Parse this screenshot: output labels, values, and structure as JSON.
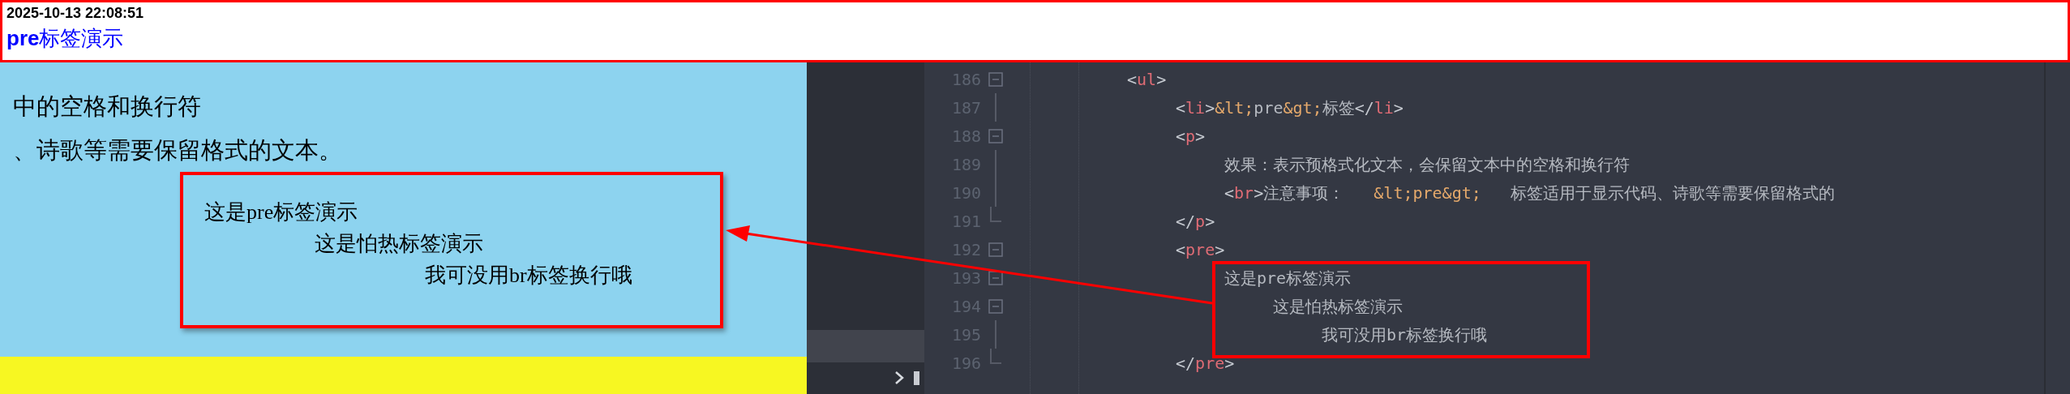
{
  "header": {
    "timestamp": "2025-10-13 22:08:51",
    "title": "**pre**标签演示"
  },
  "preview": {
    "lines": [
      "中的空格和换行符",
      "、诗歌等需要保留格式的文本。"
    ],
    "pre_lines": [
      "这是pre标签演示",
      "这是怕热标签演示",
      "我可没用br标签换行哦"
    ]
  },
  "editor": {
    "lines": [
      {
        "number": "186",
        "kind": "box",
        "tokens": [
          {
            "kind": "punct",
            "text": "<"
          },
          {
            "kind": "tag",
            "text": "ul"
          },
          {
            "kind": "punct",
            "text": ">"
          }
        ],
        "children": [
          {
            "number": "187",
            "kind": "line",
            "tokens": [
              {
                "kind": "punct",
                "text": "<"
              },
              {
                "kind": "tag",
                "text": "li"
              },
              {
                "kind": "punct",
                "text": ">"
              },
              {
                "kind": "entity",
                "text": "&lt;"
              },
              {
                "kind": "text",
                "text": "pre"
              },
              {
                "kind": "entity",
                "text": "&gt;"
              },
              {
                "kind": "text",
                "text": "标签"
              },
              {
                "kind": "punct",
                "text": "</"
              },
              {
                "kind": "tag",
                "text": "li"
              },
              {
                "kind": "punct",
                "text": ">"
              }
            ]
          },
          {
            "number": "188",
            "kind": "box",
            "tokens": [
              {
                "kind": "punct",
                "text": "<"
              },
              {
                "kind": "tag",
                "text": "p"
              },
              {
                "kind": "punct",
                "text": ">"
              }
            ],
            "children": [
              {
                "number": "189",
                "kind": "line",
                "tokens": [
                  {
                    "kind": "text",
                    "text": "效果：表示预格式化文本，会保留文本中的空格和换行符"
                  }
                ]
              },
              {
                "number": "190",
                "kind": "line",
                "tokens": [
                  {
                    "kind": "punct",
                    "text": "<"
                  },
                  {
                    "kind": "tag",
                    "text": "br"
                  },
                  {
                    "kind": "punct",
                    "text": ">"
                  },
                  {
                    "kind": "text",
                    "text": "注意事项：   "
                  },
                  {
                    "kind": "entity",
                    "text": "&lt;pre&gt;"
                  },
                  {
                    "kind": "text",
                    "text": "   标签适用于显示代码、诗歌等需要保留格式的"
                  }
                ]
              }
            ]
          },
          {
            "number": "191",
            "kind": "end",
            "tokens": [
              {
                "kind": "punct",
                "text": "</"
              },
              {
                "kind": "tag",
                "text": "p"
              },
              {
                "kind": "punct",
                "text": ">"
              }
            ]
          },
          {
            "number": "192",
            "kind": "box",
            "tokens": [
              {
                "kind": "punct",
                "text": "<"
              },
              {
                "kind": "tag",
                "text": "pre"
              },
              {
                "kind": "punct",
                "text": ">"
              }
            ],
            "children": [
              {
                "number": "193",
                "kind": "box",
                "tokens": [
                  {
                    "kind": "text",
                    "text": "这是pre标签演示"
                  }
                ],
                "children": [
                  {
                    "number": "194",
                    "kind": "box",
                    "tokens": [
                      {
                        "kind": "text",
                        "text": "这是怕热标签演示"
                      }
                    ],
                    "children": [
                      {
                        "number": "195",
                        "kind": "line",
                        "tokens": [
                          {
                            "kind": "text",
                            "text": "我可没用br标签换行哦"
                          }
                        ]
                      }
                    ]
                  }
                ]
              }
            ]
          },
          {
            "number": "196",
            "kind": "end",
            "tokens": [
              {
                "kind": "punct",
                "text": "</"
              },
              {
                "kind": "tag",
                "text": "pre"
              },
              {
                "kind": "punct",
                "text": ">"
              }
            ]
          }
        ]
      }
    ]
  }
}
